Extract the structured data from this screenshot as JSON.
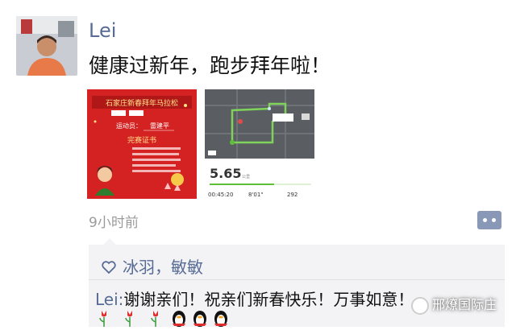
{
  "post": {
    "author": "Lei",
    "text": "健康过新年，跑步拜年啦！",
    "time": "9小时前"
  },
  "images": {
    "certificate": {
      "title": "石家庄新春拜年马拉松",
      "athlete_label": "运动员：",
      "athlete_name": "雷建平",
      "cert_title": "完赛证书"
    },
    "run_map": {
      "distance": "5.65",
      "distance_unit": "公里",
      "duration": "00:45:20",
      "pace": "8'01\"",
      "calories": "292"
    }
  },
  "interactions": {
    "likes": "冰羽，敏敏",
    "comment_author": "Lei:",
    "comment_text": "谢谢亲们！祝亲们新春快乐！万事如意！"
  },
  "emoji_icons": [
    "tulip-icon",
    "tulip-icon",
    "tulip-icon",
    "penguin-icon",
    "penguin-icon",
    "penguin-icon"
  ],
  "watermark": "邢燎国际庄",
  "colors": {
    "link": "#576b95",
    "panel": "#f3f3f5",
    "cert_red": "#cc1f1f",
    "route_green": "#7fd35a"
  }
}
